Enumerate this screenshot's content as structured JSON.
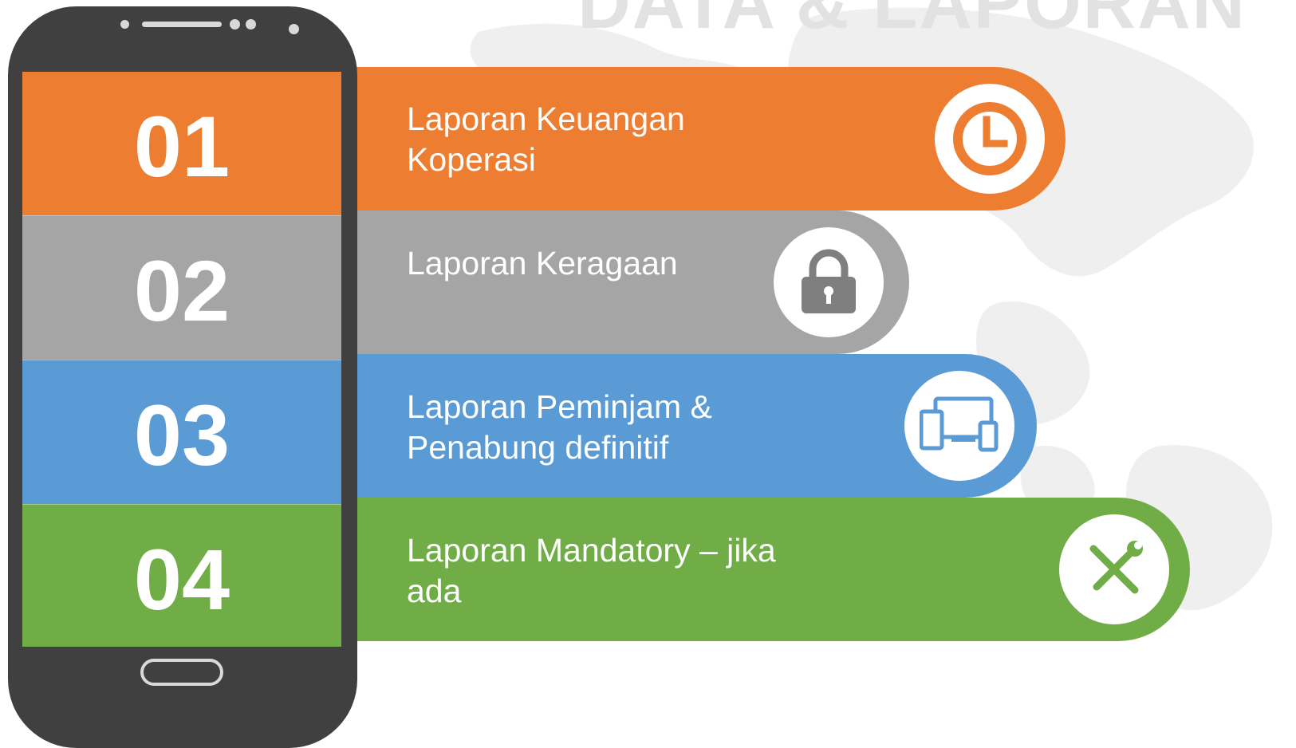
{
  "title": "DATA & LAPORAN",
  "colors": {
    "orange": "#ED7D31",
    "gray": "#A5A5A5",
    "blue": "#5B9BD5",
    "green": "#70AD47",
    "phone_body": "#404040"
  },
  "items": [
    {
      "number": "01",
      "line1": "Laporan Keuangan",
      "line2": "Koperasi",
      "icon": "clock-icon",
      "color": "#ED7D31"
    },
    {
      "number": "02",
      "line1": "Laporan Keragaan",
      "line2": "",
      "icon": "lock-icon",
      "color": "#A5A5A5"
    },
    {
      "number": "03",
      "line1": "Laporan Peminjam &",
      "line2": "Penabung definitif",
      "icon": "devices-icon",
      "color": "#5B9BD5"
    },
    {
      "number": "04",
      "line1": "Laporan Mandatory – jika",
      "line2": "ada",
      "icon": "tools-icon",
      "color": "#70AD47"
    }
  ]
}
